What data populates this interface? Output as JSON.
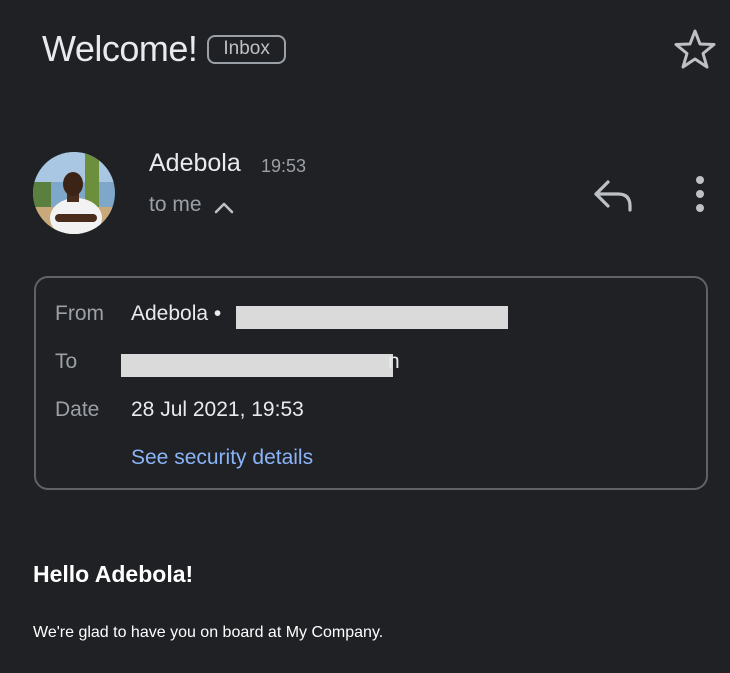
{
  "header": {
    "subject": "Welcome!",
    "label": "Inbox",
    "star_icon": "star-outline-icon"
  },
  "message": {
    "sender_name": "Adebola",
    "time": "19:53",
    "recipient_summary": "to me",
    "avatar_icon": "sender-avatar",
    "reply_icon": "reply-icon",
    "more_icon": "more-vert-icon"
  },
  "details": {
    "from_label": "From",
    "from_value": "Adebola •",
    "to_label": "To",
    "to_value": "",
    "to_tail": "n",
    "date_label": "Date",
    "date_value": "28 Jul 2021, 19:53",
    "security_link": "See security details"
  },
  "body": {
    "greeting": "Hello Adebola!",
    "text": "We're glad to have you on board at My Company."
  },
  "colors": {
    "background": "#202124",
    "link": "#8ab4f8",
    "muted": "#9aa0a6",
    "border": "#5f6368"
  }
}
